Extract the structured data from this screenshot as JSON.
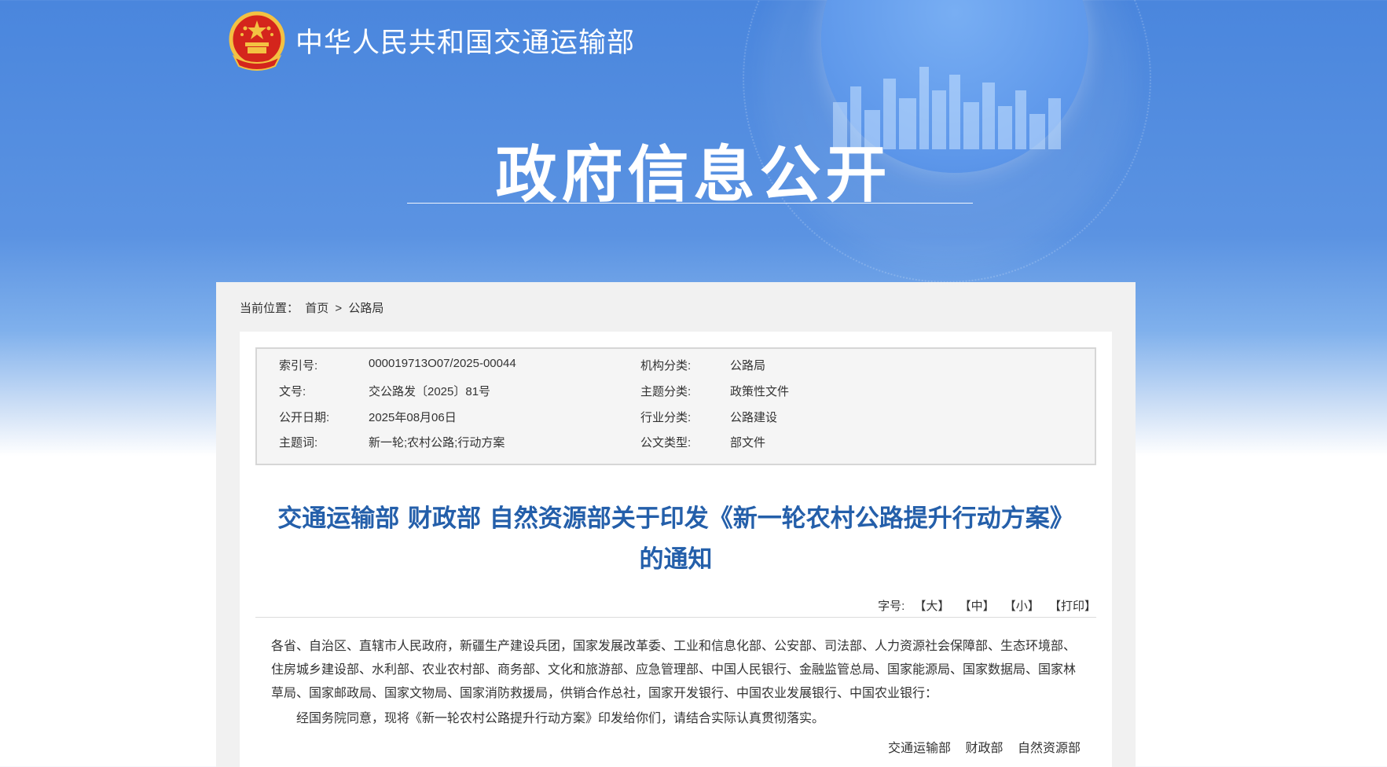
{
  "header": {
    "site_name": "中华人民共和国交通运输部",
    "banner_title": "政府信息公开",
    "logo_icon": "national-emblem-icon"
  },
  "breadcrumb": {
    "prefix": "当前位置：",
    "home": "首页",
    "separator": ">",
    "current": "公路局"
  },
  "meta": {
    "index_label": "索引号:",
    "index_value": "000019713O07/2025-00044",
    "org_label": "机构分类:",
    "org_value": "公路局",
    "doc_no_label": "文号:",
    "doc_no_value": "交公路发〔2025〕81号",
    "topic_label": "主题分类:",
    "topic_value": "政策性文件",
    "date_label": "公开日期:",
    "date_value": "2025年08月06日",
    "industry_label": "行业分类:",
    "industry_value": "公路建设",
    "keywords_label": "主题词:",
    "keywords_value": "新一轮;农村公路;行动方案",
    "type_label": "公文类型:",
    "type_value": "部文件"
  },
  "document": {
    "title_line1": "交通运输部 财政部 自然资源部关于印发《新一轮农村公路提升行动方案》",
    "title_line2": "的通知",
    "font_size_label": "字号:",
    "font_large": "【大】",
    "font_medium": "【中】",
    "font_small": "【小】",
    "print": "【打印】",
    "recipients": "各省、自治区、直辖市人民政府，新疆生产建设兵团，国家发展改革委、工业和信息化部、公安部、司法部、人力资源社会保障部、生态环境部、住房城乡建设部、水利部、农业农村部、商务部、文化和旅游部、应急管理部、中国人民银行、金融监管总局、国家能源局、国家数据局、国家林草局、国家邮政局、国家文物局、国家消防救援局，供销合作总社，国家开发银行、中国农业发展银行、中国农业银行：",
    "paragraph": "经国务院同意，现将《新一轮农村公路提升行动方案》印发给你们，请结合实际认真贯彻落实。",
    "signer1": "交通运输部",
    "signer2": "财政部",
    "signer3": "自然资源部"
  },
  "colors": {
    "banner_blue": "#4a86dd",
    "title_blue": "#245faa"
  }
}
